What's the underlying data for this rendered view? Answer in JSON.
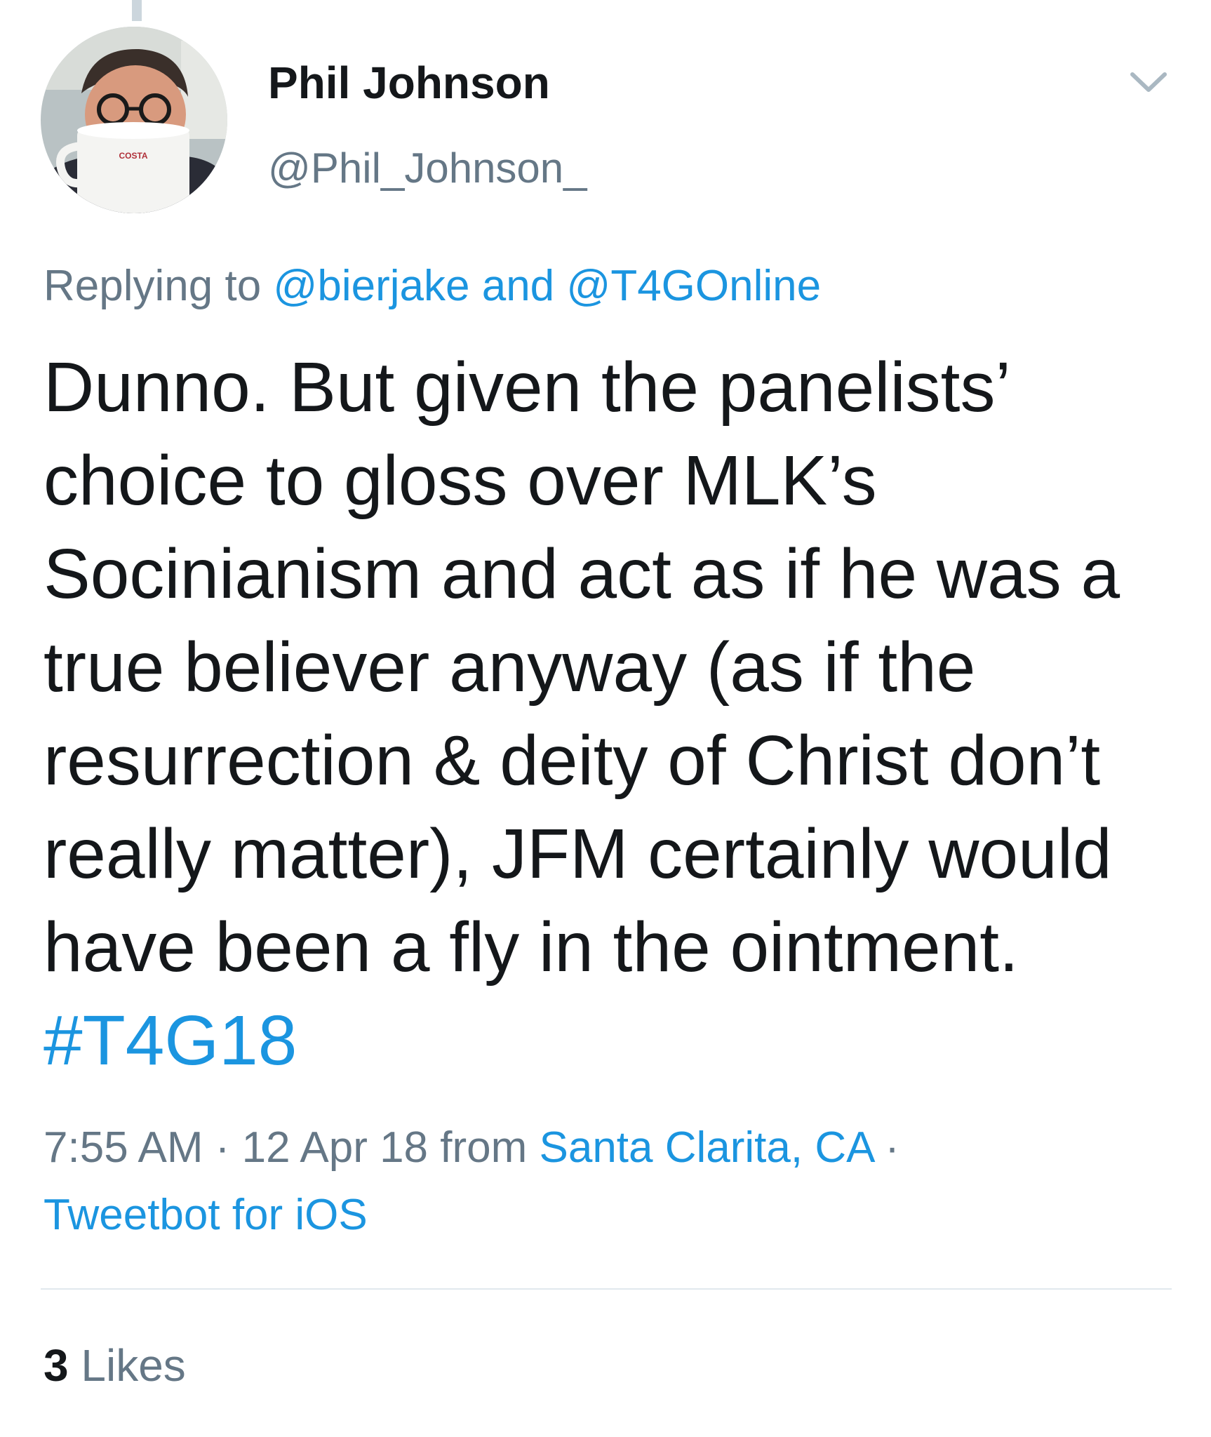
{
  "tweet": {
    "author": {
      "name": "Phil Johnson",
      "handle": "@Phil_Johnson_",
      "avatar_mug_text": "COSTA"
    },
    "replying": {
      "prefix": "Replying to ",
      "user1": "@bierjake",
      "conjunction": " and ",
      "user2": "@T4GOnline"
    },
    "text": {
      "body": "Dunno. But given the panelists’ choice to gloss over MLK’s Socinianism and act as if he was a true believer anyway (as if the resurrection & deity of Christ don’t really matter), JFM certainly would have been a fly in the ointment. ",
      "hashtag": "#T4G18"
    },
    "meta": {
      "time": "7:55 AM",
      "sep1": " · ",
      "date": "12 Apr 18",
      "from": " from ",
      "location": "Santa Clarita, CA",
      "sep2": " · ",
      "client": "Tweetbot for iOS"
    },
    "likes": {
      "count": "3",
      "label": " Likes"
    }
  },
  "icons": {
    "more_menu": "chevron-down-icon"
  },
  "colors": {
    "link": "#1b95e0",
    "secondary_text": "#657786",
    "primary_text": "#14171a",
    "divider": "#e1e8ed"
  }
}
